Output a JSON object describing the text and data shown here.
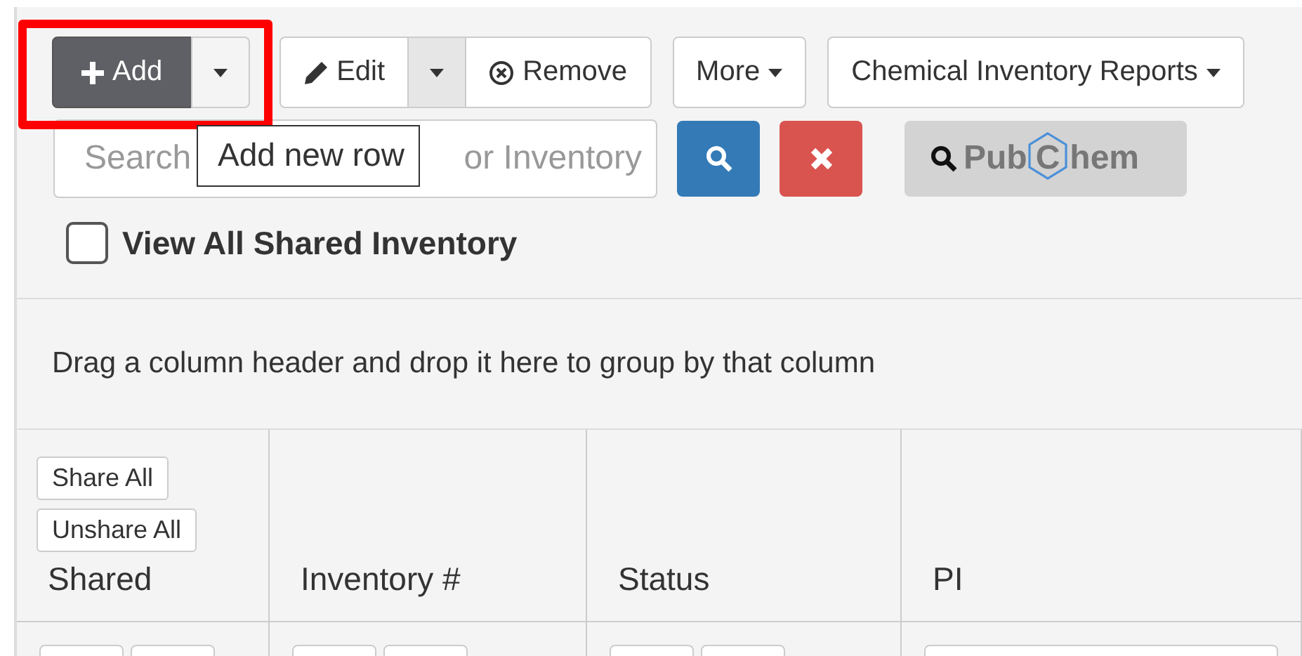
{
  "toolbar": [
    {
      "highlighted": true,
      "buttons": [
        {
          "kind": "add",
          "label": "Add"
        },
        {
          "kind": "toggle"
        }
      ]
    },
    {
      "highlighted": false,
      "buttons": [
        {
          "kind": "edit",
          "label": "Edit"
        },
        {
          "kind": "toggle"
        },
        {
          "kind": "remove",
          "label": "Remove"
        }
      ]
    },
    {
      "highlighted": false,
      "buttons": [
        {
          "kind": "dropdown",
          "label": "More"
        }
      ]
    },
    {
      "highlighted": false,
      "buttons": [
        {
          "kind": "dropdown",
          "label": "Chemical Inventory Reports"
        }
      ]
    }
  ],
  "tooltip": "Add new row",
  "search": {
    "placeholder_start": "Search",
    "placeholder_end": "or Inventory"
  },
  "pubchem": {
    "parts": [
      "Pub",
      "C",
      "hem"
    ]
  },
  "view_all_shared": {
    "label": "View All Shared Inventory",
    "checked": false
  },
  "group_panel": "Drag a column header and drop it here to group by that column",
  "table": {
    "columns": [
      {
        "label": "Shared",
        "buttons": [
          "Share All",
          "Unshare All"
        ]
      },
      {
        "label": "Inventory #"
      },
      {
        "label": "Status"
      },
      {
        "label": "PI"
      }
    ]
  }
}
